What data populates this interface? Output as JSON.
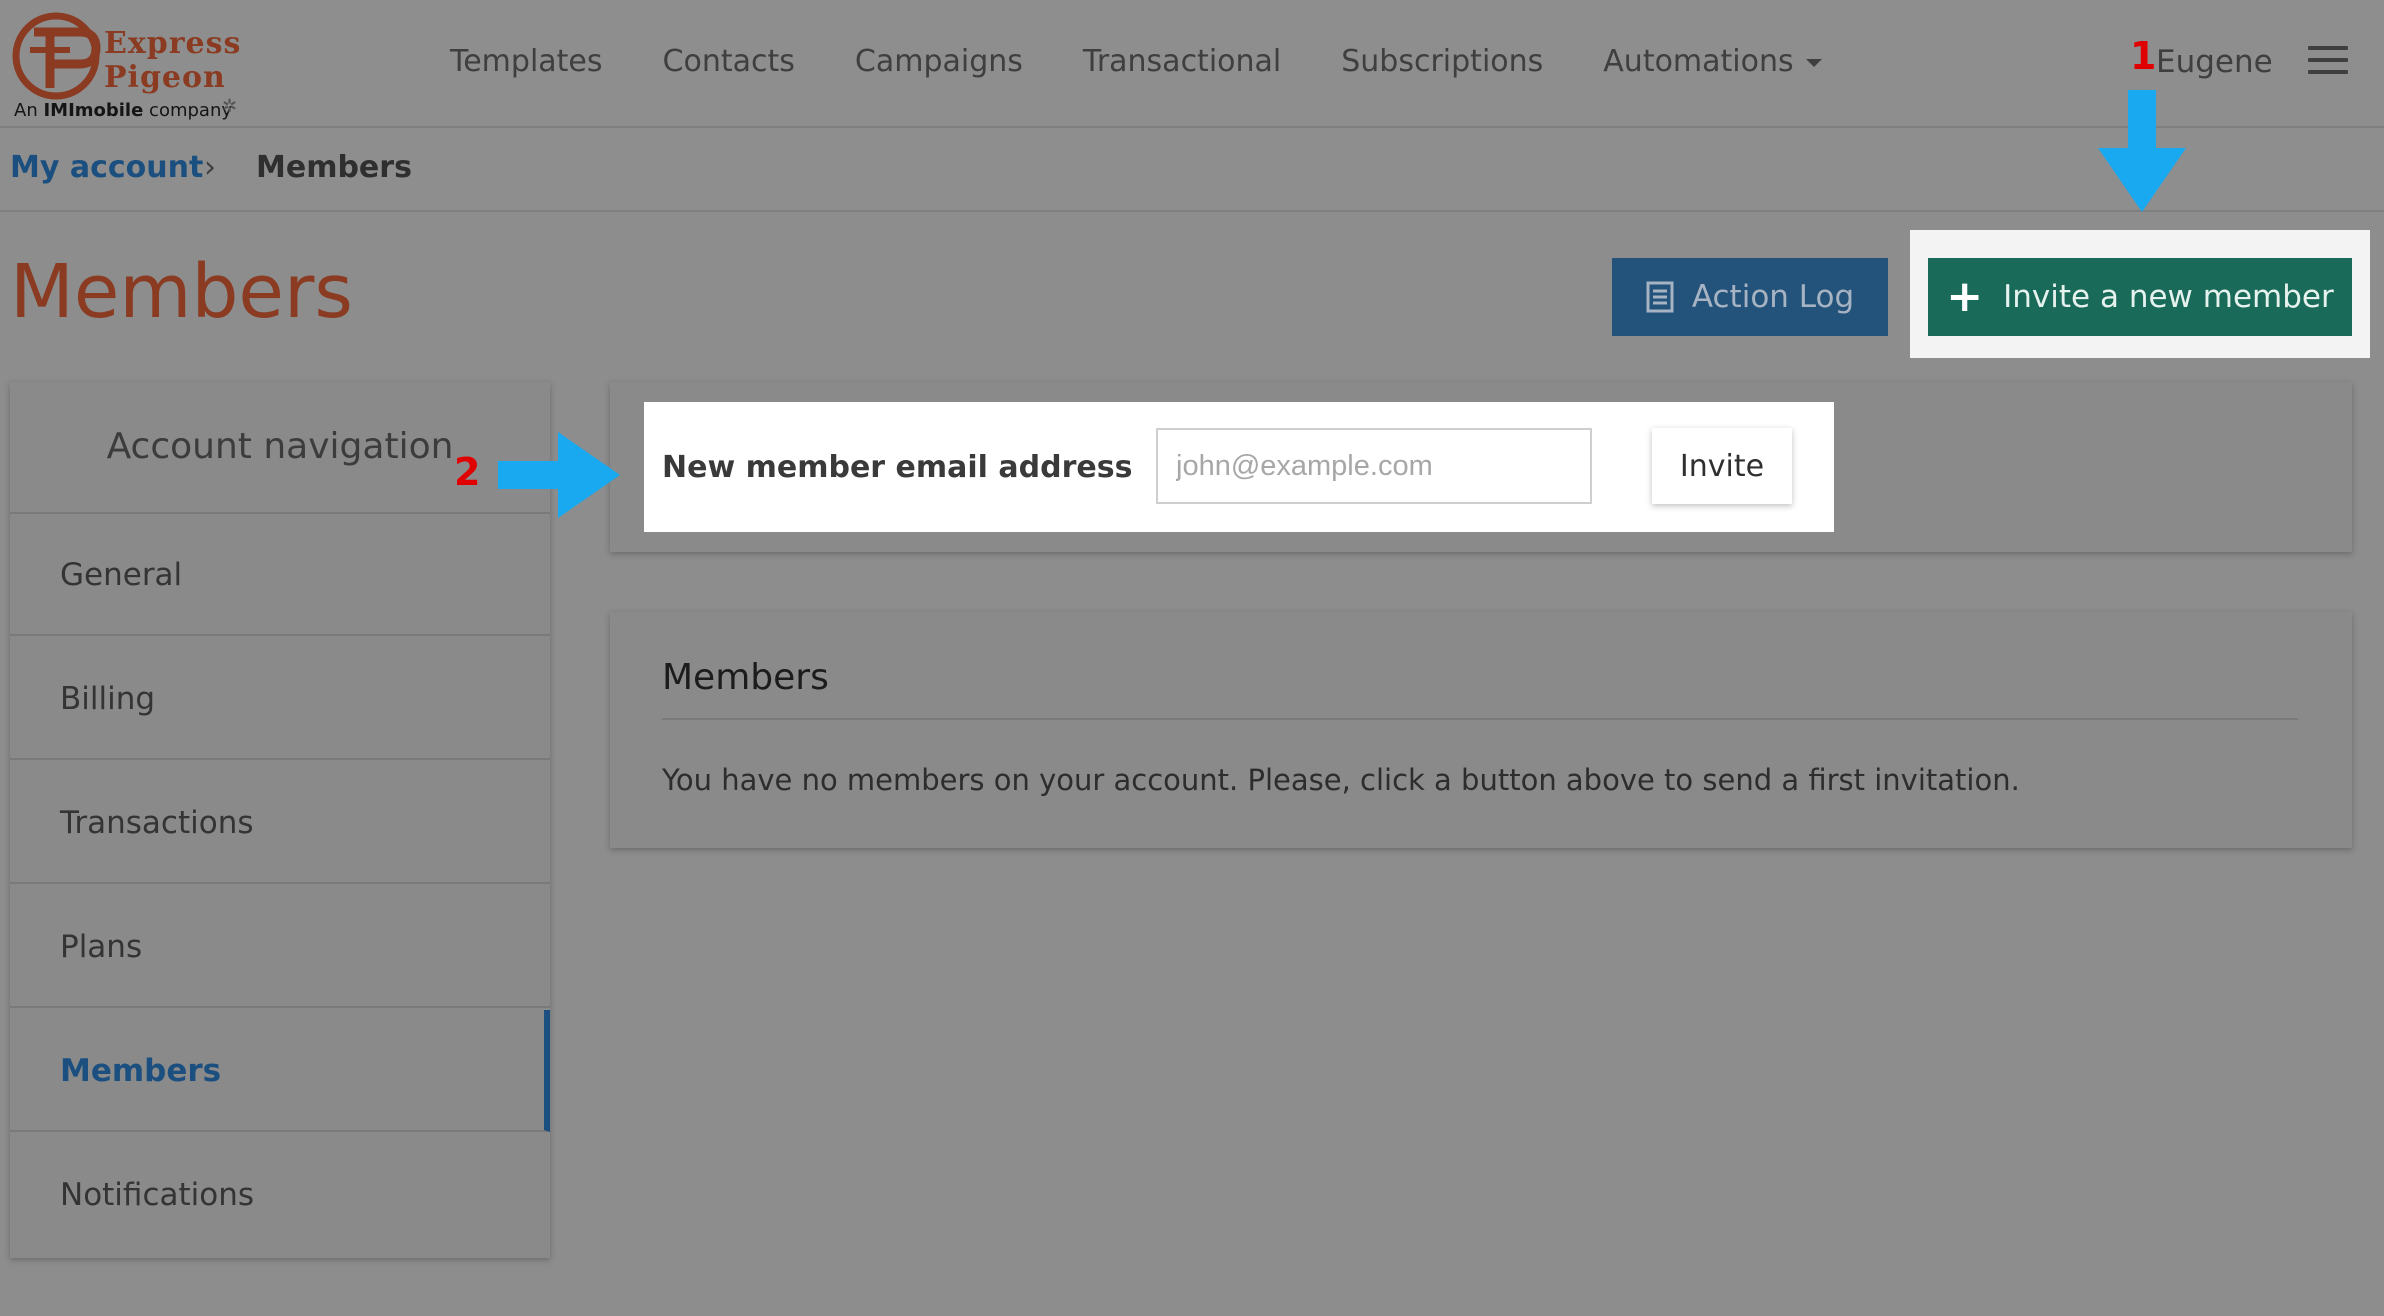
{
  "logo": {
    "word1": "Express",
    "word2": "Pigeon",
    "sub_prefix": "An ",
    "sub_brand": "IMImobile",
    "sub_suffix": " company"
  },
  "nav": {
    "items": [
      {
        "label": "Templates"
      },
      {
        "label": "Contacts"
      },
      {
        "label": "Campaigns"
      },
      {
        "label": "Transactional"
      },
      {
        "label": "Subscriptions"
      },
      {
        "label": "Automations"
      }
    ]
  },
  "user": {
    "name": "Eugene"
  },
  "annotations": {
    "step1": "1",
    "step2": "2",
    "arrow_color": "#18a9f0",
    "number_color": "#e00000"
  },
  "breadcrumb": {
    "parent": "My account",
    "separator": "›",
    "current": "Members"
  },
  "page": {
    "title": "Members"
  },
  "actions": {
    "action_log": "Action Log",
    "invite_new_member": "Invite a new member"
  },
  "sidebar": {
    "heading": "Account navigation",
    "items": [
      {
        "label": "General"
      },
      {
        "label": "Billing"
      },
      {
        "label": "Transactions"
      },
      {
        "label": "Plans"
      },
      {
        "label": "Members",
        "active": true
      },
      {
        "label": "Notifications"
      }
    ]
  },
  "invite_form": {
    "label": "New member email address",
    "placeholder": "john@example.com",
    "value": "",
    "button": "Invite"
  },
  "members_panel": {
    "title": "Members",
    "empty_message": "You have no members on your account. Please, click a button above to send a first invitation."
  },
  "colors": {
    "brand": "#8a3b22",
    "primary": "#23527a",
    "success": "#1a6a5a",
    "link": "#1b4f7f"
  }
}
